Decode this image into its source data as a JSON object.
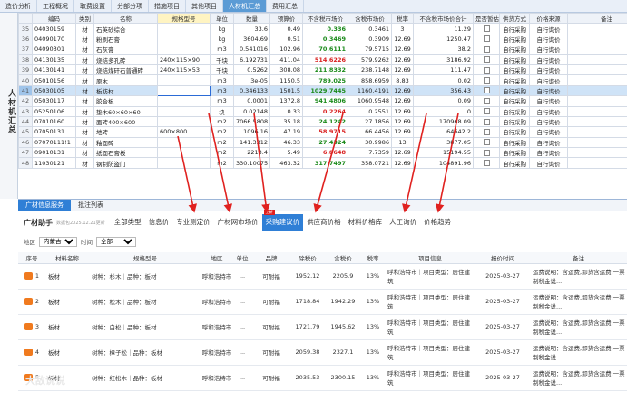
{
  "topbar": {
    "tabs": [
      "造价分析",
      "工程概况",
      "取费设置",
      "分部分项",
      "措施项目",
      "其他项目",
      "人材机汇总",
      "费用汇总"
    ],
    "active": "人材机汇总"
  },
  "side_title": "人材机汇总",
  "grid": {
    "columns": [
      "",
      "编码",
      "类别",
      "名称",
      "规格型号",
      "单位",
      "数量",
      "预算价",
      "不含税市场价",
      "含税市场价",
      "税率",
      "不含税市场价合计",
      "是否暂估",
      "供货方式",
      "价格来源",
      "备注"
    ],
    "rows": [
      {
        "n": "35",
        "code": "04030159",
        "cat": "材",
        "name": "石英砂综合",
        "spec": "",
        "unit": "kg",
        "qty": "33.6",
        "budget": "0.49",
        "mkt": "0.336",
        "mkt_color": "green",
        "mkt_tax": "0.3461",
        "rate": "3",
        "total": "11.29",
        "supply": "自行采购",
        "src": "自行询价"
      },
      {
        "n": "36",
        "code": "04090170",
        "cat": "材",
        "name": "粉刷石膏",
        "spec": "",
        "unit": "kg",
        "qty": "3604.69",
        "budget": "0.51",
        "mkt": "0.3469",
        "mkt_color": "green",
        "mkt_tax": "0.3909",
        "rate": "12.69",
        "total": "1250.47",
        "supply": "自行采购",
        "src": "自行询价"
      },
      {
        "n": "37",
        "code": "04090301",
        "cat": "材",
        "name": "石灰膏",
        "spec": "",
        "unit": "m3",
        "qty": "0.541016",
        "budget": "102.96",
        "mkt": "70.6111",
        "mkt_color": "green",
        "mkt_tax": "79.5715",
        "rate": "12.69",
        "total": "38.2",
        "supply": "自行采购",
        "src": "自行询价"
      },
      {
        "n": "38",
        "code": "04130135",
        "cat": "材",
        "name": "烧结多孔砖",
        "spec": "240×115×90",
        "unit": "千块",
        "qty": "6.192731",
        "budget": "411.04",
        "mkt": "514.6226",
        "mkt_color": "red",
        "mkt_tax": "579.9262",
        "rate": "12.69",
        "total": "3186.92",
        "supply": "自行采购",
        "src": "自行询价"
      },
      {
        "n": "39",
        "code": "04130141",
        "cat": "材",
        "name": "烧结煤矸石普通砖",
        "spec": "240×115×53",
        "unit": "千块",
        "qty": "0.5262",
        "budget": "308.08",
        "mkt": "211.8332",
        "mkt_color": "green",
        "mkt_tax": "238.7148",
        "rate": "12.69",
        "total": "111.47",
        "supply": "自行采购",
        "src": "自行询价"
      },
      {
        "n": "40",
        "code": "05010156",
        "cat": "材",
        "name": "原木",
        "spec": "",
        "unit": "m3",
        "qty": "3e-05",
        "budget": "1150.5",
        "mkt": "789.025",
        "mkt_color": "green",
        "mkt_tax": "858.6959",
        "rate": "8.83",
        "total": "0.02",
        "supply": "自行采购",
        "src": "自行询价"
      },
      {
        "n": "41",
        "code": "05030105",
        "cat": "材",
        "name": "板枋材",
        "spec": "",
        "unit": "m3",
        "qty": "0.346133",
        "budget": "1501.5",
        "mkt": "1029.7445",
        "mkt_color": "green",
        "mkt_tax": "1160.4191",
        "rate": "12.69",
        "total": "356.43",
        "supply": "自行采购",
        "src": "自行询价",
        "selected": true
      },
      {
        "n": "42",
        "code": "05030117",
        "cat": "材",
        "name": "胶合板",
        "spec": "",
        "unit": "m3",
        "qty": "0.0001",
        "budget": "1372.8",
        "mkt": "941.4806",
        "mkt_color": "green",
        "mkt_tax": "1060.9548",
        "rate": "12.69",
        "total": "0.09",
        "supply": "自行采购",
        "src": "自行询价"
      },
      {
        "n": "43",
        "code": "05250106",
        "cat": "材",
        "name": "垫木60×60×60",
        "spec": "",
        "unit": "块",
        "qty": "0.02148",
        "budget": "0.33",
        "mkt": "0.2264",
        "mkt_color": "red",
        "mkt_tax": "0.2551",
        "rate": "12.69",
        "total": "0",
        "supply": "自行采购",
        "src": "自行询价"
      },
      {
        "n": "44",
        "code": "07010160",
        "cat": "材",
        "name": "面砖400×600",
        "spec": "",
        "unit": "m2",
        "qty": "7066.5808",
        "budget": "35.18",
        "mkt": "24.1242",
        "mkt_color": "green",
        "mkt_tax": "27.1856",
        "rate": "12.69",
        "total": "170968.09",
        "supply": "自行采购",
        "src": "自行询价"
      },
      {
        "n": "45",
        "code": "07050131",
        "cat": "材",
        "name": "地砖",
        "spec": "600×800",
        "unit": "m2",
        "qty": "1096.16",
        "budget": "47.19",
        "mkt": "58.9715",
        "mkt_color": "red",
        "mkt_tax": "66.4456",
        "rate": "12.69",
        "total": "64642.2",
        "supply": "自行采购",
        "src": "自行询价"
      },
      {
        "n": "46",
        "code": "07070111!1",
        "cat": "材",
        "name": "釉面砖",
        "spec": "",
        "unit": "m2",
        "qty": "141.3312",
        "budget": "46.33",
        "mkt": "27.4324",
        "mkt_color": "green",
        "mkt_tax": "30.9986",
        "rate": "13",
        "total": "3877.05",
        "supply": "自行采购",
        "src": "自行询价"
      },
      {
        "n": "47",
        "code": "09010131",
        "cat": "材",
        "name": "纸面石膏板",
        "spec": "",
        "unit": "m2",
        "qty": "2213.4",
        "budget": "5.49",
        "mkt": "6.8648",
        "mkt_color": "red",
        "mkt_tax": "7.7359",
        "rate": "12.69",
        "total": "15194.55",
        "supply": "自行采购",
        "src": "自行询价"
      },
      {
        "n": "48",
        "code": "11030121",
        "cat": "材",
        "name": "钢制防盗门",
        "spec": "",
        "unit": "m2",
        "qty": "330.10075",
        "budget": "463.32",
        "mkt": "317.7497",
        "mkt_color": "green",
        "mkt_tax": "358.0721",
        "rate": "12.69",
        "total": "104891.96",
        "supply": "自行采购",
        "src": "自行询价"
      }
    ]
  },
  "panel": {
    "tabs": [
      "广材信息服务",
      "批注列表"
    ],
    "active_tab": "广材信息服务",
    "assistant": "广材助手",
    "version": "数据包2025.12.21更新",
    "nav": [
      "全部类型",
      "信息价",
      "专业测定价",
      "广材网市场价",
      "采购建议价",
      "供应商价格",
      "材料价格库",
      "人工询价",
      "价格趋势"
    ],
    "nav_active": "采购建议价",
    "nav_badge": "上新",
    "filter": {
      "region_label": "地区",
      "region_value": "内蒙古",
      "time_label": "时间",
      "time_value": "全部"
    },
    "columns": [
      "序号",
      "材料名称",
      "规格型号",
      "地区",
      "单位",
      "品牌",
      "除税价",
      "含税价",
      "税率",
      "项目信息",
      "报价时间",
      "备注"
    ],
    "rows": [
      {
        "n": "1",
        "name": "板材",
        "spec": "树种：杉木｜品种：板材",
        "region": "呼和浩特市",
        "unit": "...",
        "brand": "可耐福",
        "price": "1952.12",
        "price_tax": "2205.9",
        "rate": "13%",
        "project": "呼和浩特市｜项目类型：居住建筑",
        "date": "2025-03-27",
        "note": "运费说明：含运费,卸货含运费,一票制税金说..."
      },
      {
        "n": "2",
        "name": "板材",
        "spec": "树种：松木｜品种：板材",
        "region": "呼和浩特市",
        "unit": "...",
        "brand": "可耐福",
        "price": "1718.84",
        "price_tax": "1942.29",
        "rate": "13%",
        "project": "呼和浩特市｜项目类型：居住建筑",
        "date": "2025-03-27",
        "note": "运费说明：含运费,卸货含运费,一票制税金说..."
      },
      {
        "n": "3",
        "name": "板材",
        "spec": "树种：白松｜品种：板材",
        "region": "呼和浩特市",
        "unit": "...",
        "brand": "可耐福",
        "price": "1721.79",
        "price_tax": "1945.62",
        "rate": "13%",
        "project": "呼和浩特市｜项目类型：居住建筑",
        "date": "2025-03-27",
        "note": "运费说明：含运费,卸货含运费,一票制税金说..."
      },
      {
        "n": "4",
        "name": "板材",
        "spec": "树种：樟子松｜品种：板材",
        "region": "呼和浩特市",
        "unit": "...",
        "brand": "可耐福",
        "price": "2059.38",
        "price_tax": "2327.1",
        "rate": "13%",
        "project": "呼和浩特市｜项目类型：居住建筑",
        "date": "2025-03-27",
        "note": "运费说明：含运费,卸货含运费,一票制税金说..."
      },
      {
        "n": "5",
        "name": "板材",
        "spec": "树种：红松木｜品种：板材",
        "region": "呼和浩特市",
        "unit": "...",
        "brand": "可耐福",
        "price": "2035.53",
        "price_tax": "2300.15",
        "rate": "13%",
        "project": "呼和浩特市｜项目类型：居住建筑",
        "date": "2025-03-27",
        "note": "运费说明：含运费,卸货含运费,一票制税金说..."
      }
    ]
  },
  "watermark": "大敌说说",
  "colors": {
    "accent": "#2f7fd6",
    "arrow": "#e0211f",
    "green": "#1a8a1a",
    "red": "#d92020"
  }
}
